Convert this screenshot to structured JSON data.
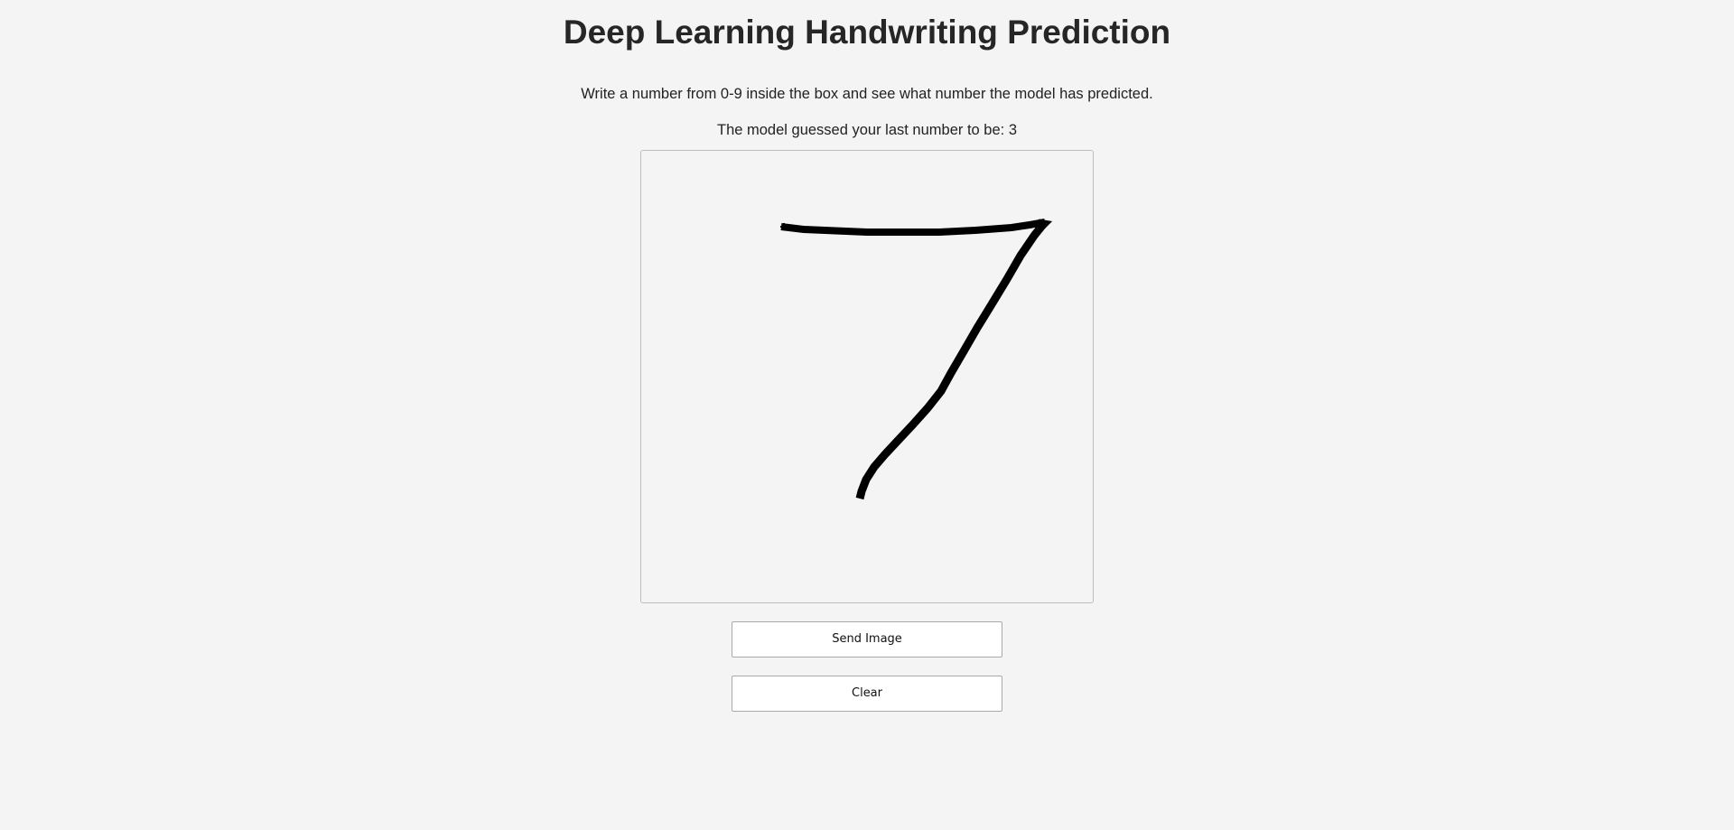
{
  "header": {
    "title": "Deep Learning Handwriting Prediction"
  },
  "main": {
    "instructions": "Write a number from 0-9 inside the box and see what number the model has predicted.",
    "prediction_text": "The model guessed your last number to be: 3"
  },
  "drawing": {
    "stroke_color": "#000000"
  },
  "buttons": {
    "send_label": "Send Image",
    "clear_label": "Clear"
  }
}
